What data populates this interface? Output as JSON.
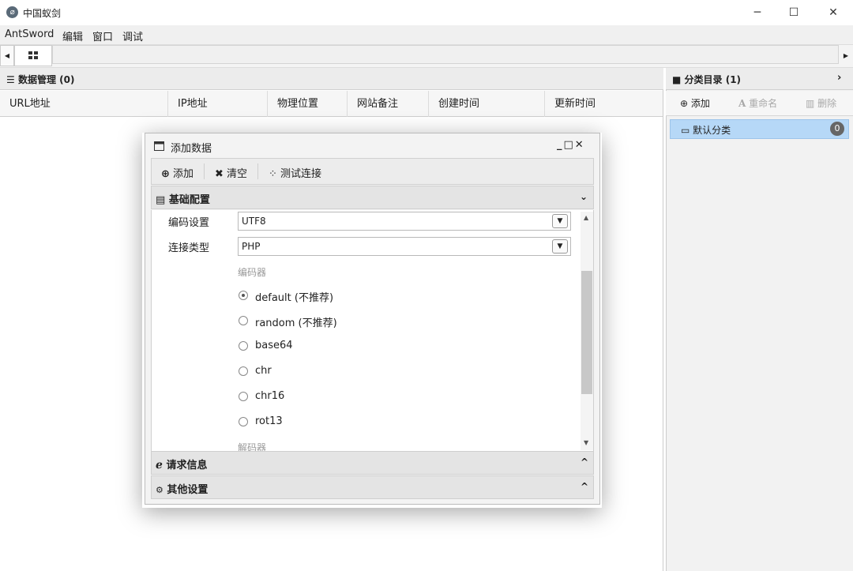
{
  "window": {
    "title": "中国蚁剑"
  },
  "menubar": [
    "AntSword",
    "编辑",
    "窗口",
    "调试"
  ],
  "data_panel": {
    "title": "数据管理 (0)",
    "columns": [
      "URL地址",
      "IP地址",
      "物理位置",
      "网站备注",
      "创建时间",
      "更新时间"
    ]
  },
  "category_panel": {
    "title": "分类目录 (1)",
    "toolbar": {
      "add": "添加",
      "rename": "重命名",
      "delete": "删除"
    },
    "items": [
      {
        "label": "默认分类",
        "count": "0"
      }
    ]
  },
  "dialog": {
    "title": "添加数据",
    "toolbar": {
      "add": "添加",
      "clear": "清空",
      "test": "测试连接"
    },
    "sections": {
      "basic": "基础配置",
      "request": "请求信息",
      "other": "其他设置"
    },
    "fields": {
      "encoding_label": "编码设置",
      "encoding_value": "UTF8",
      "type_label": "连接类型",
      "type_value": "PHP"
    },
    "encoder_caption": "编码器",
    "encoders": [
      "default (不推荐)",
      "random (不推荐)",
      "base64",
      "chr",
      "chr16",
      "rot13"
    ],
    "selected_encoder": "default (不推荐)",
    "decoder_caption": "解码器"
  },
  "colors": {
    "selection": "#b6d8f7",
    "panel_header": "#ececec",
    "badge": "#666666"
  }
}
